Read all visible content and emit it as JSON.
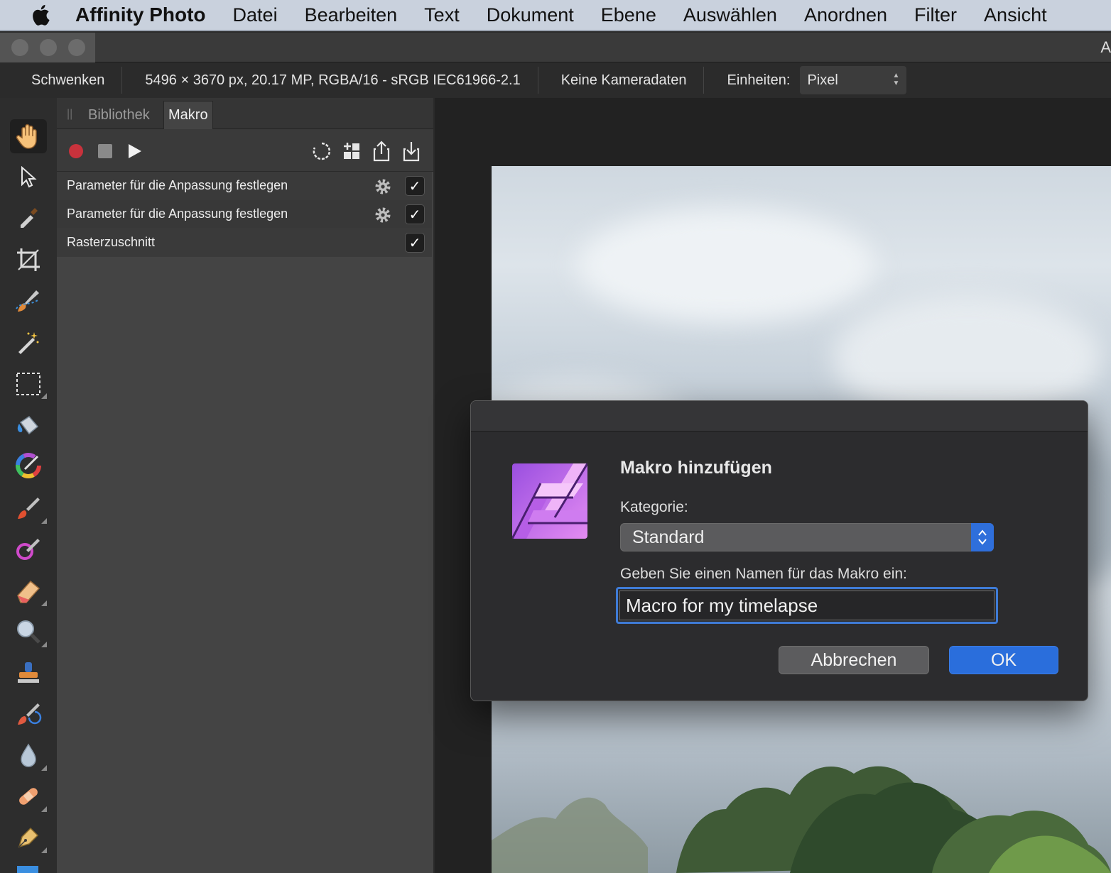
{
  "menubar": {
    "app_name": "Affinity Photo",
    "items": [
      "Datei",
      "Bearbeiten",
      "Text",
      "Dokument",
      "Ebene",
      "Auswählen",
      "Anordnen",
      "Filter",
      "Ansicht"
    ]
  },
  "window": {
    "title_fragment": "A"
  },
  "context_toolbar": {
    "tool_name": "Schwenken",
    "document_info": "5496 × 3670 px, 20.17 MP, RGBA/16 - sRGB IEC61966-2.1",
    "camera_info": "Keine Kameradaten",
    "units_label": "Einheiten:",
    "units_value": "Pixel"
  },
  "tools": [
    {
      "name": "hand-tool",
      "active": true
    },
    {
      "name": "move-tool"
    },
    {
      "name": "color-picker-tool"
    },
    {
      "name": "crop-tool"
    },
    {
      "name": "selection-brush-tool"
    },
    {
      "name": "magic-wand-tool"
    },
    {
      "name": "marquee-tool"
    },
    {
      "name": "flood-fill-tool"
    },
    {
      "name": "color-wheel"
    },
    {
      "name": "paint-brush-tool"
    },
    {
      "name": "color-replacement-tool"
    },
    {
      "name": "erase-tool"
    },
    {
      "name": "dodge-tool"
    },
    {
      "name": "clone-tool"
    },
    {
      "name": "undo-brush-tool"
    },
    {
      "name": "blur-tool"
    },
    {
      "name": "healing-tool"
    },
    {
      "name": "pen-tool"
    }
  ],
  "panel": {
    "tabs": [
      "Bibliothek",
      "Makro"
    ],
    "active_tab": "Makro",
    "rows": [
      {
        "label": "Parameter für die Anpassung festlegen",
        "has_settings": true,
        "checked": true
      },
      {
        "label": "Parameter für die Anpassung festlegen",
        "has_settings": true,
        "checked": true
      },
      {
        "label": "Rasterzuschnitt",
        "has_settings": false,
        "checked": true
      }
    ]
  },
  "dialog": {
    "heading": "Makro hinzufügen",
    "category_label": "Kategorie:",
    "category_value": "Standard",
    "name_label": "Geben Sie einen Namen für das Makro ein:",
    "name_value": "Macro for my timelapse",
    "cancel_label": "Abbrechen",
    "ok_label": "OK"
  },
  "colors": {
    "accent": "#2a6edc",
    "record": "#c8323c",
    "logo_purple": "#c466e8"
  }
}
